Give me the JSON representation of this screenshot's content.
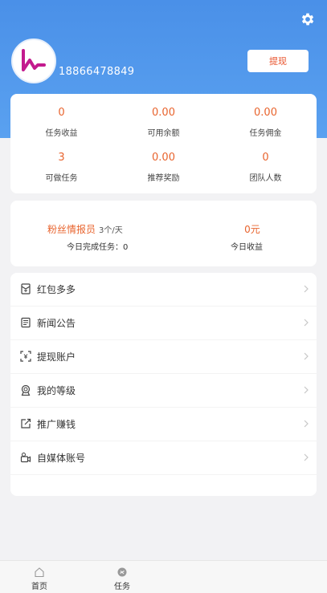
{
  "profile": {
    "phone": "18866478849",
    "withdraw_label": "提现"
  },
  "stats": [
    {
      "value": "0",
      "label": "任务收益"
    },
    {
      "value": "0.00",
      "label": "可用余额"
    },
    {
      "value": "0.00",
      "label": "任务佣金"
    },
    {
      "value": "3",
      "label": "可做任务"
    },
    {
      "value": "0.00",
      "label": "推荐奖励"
    },
    {
      "value": "0",
      "label": "团队人数"
    }
  ],
  "fans": {
    "title": "粉丝情报员",
    "rate": "3个/天",
    "completed": "今日完成任务：0",
    "today_value": "0元",
    "today_label": "今日收益"
  },
  "menu": [
    {
      "label": "红包多多",
      "icon": "red-packet-icon"
    },
    {
      "label": "新闻公告",
      "icon": "news-icon"
    },
    {
      "label": "提现账户",
      "icon": "withdraw-account-icon"
    },
    {
      "label": "我的等级",
      "icon": "level-badge-icon"
    },
    {
      "label": "推广赚钱",
      "icon": "share-icon"
    },
    {
      "label": "自媒体账号",
      "icon": "camera-icon"
    }
  ],
  "tabs": [
    {
      "label": "首页",
      "icon": "home-icon"
    },
    {
      "label": "任务",
      "icon": "task-icon"
    }
  ],
  "colors": {
    "header": "#4a90e8",
    "accent": "#e8642e"
  }
}
